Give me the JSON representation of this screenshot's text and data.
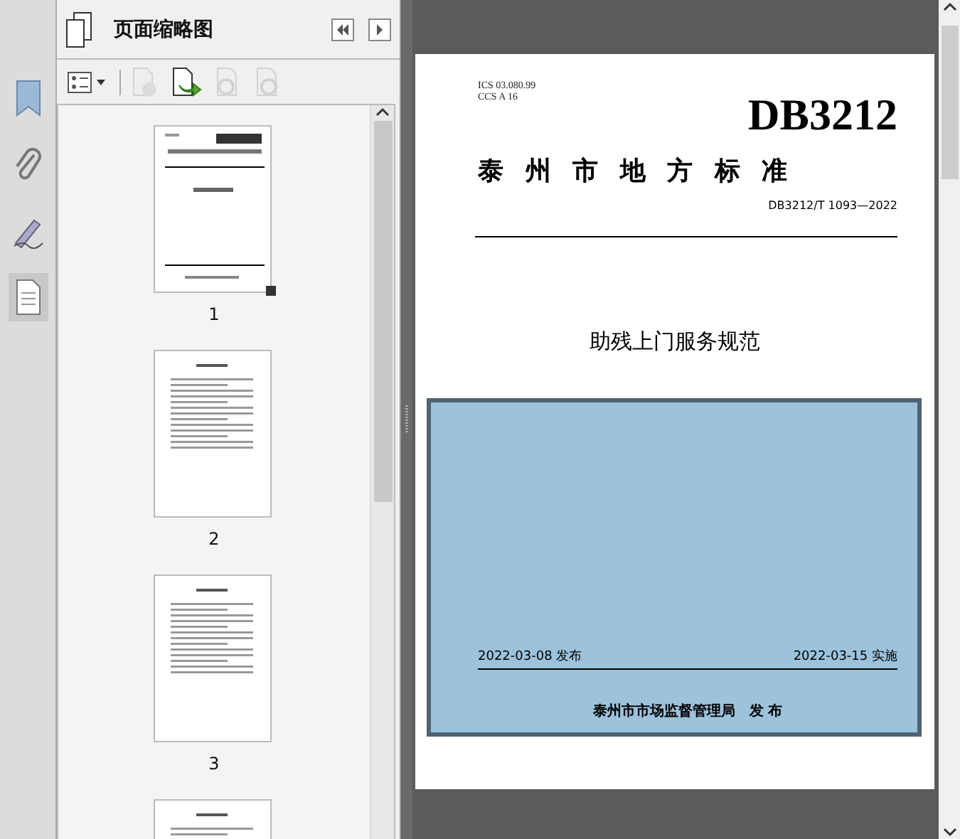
{
  "nav_strip": [
    {
      "kind": "bookmarks",
      "selected": false
    },
    {
      "kind": "attachments",
      "selected": false
    },
    {
      "kind": "signatures",
      "selected": false
    },
    {
      "kind": "pages",
      "selected": true
    }
  ],
  "thumbnail_panel": {
    "title": "页面缩略图",
    "toolbar": [
      {
        "kind": "options",
        "disabled": false
      },
      {
        "kind": "delete",
        "disabled": true
      },
      {
        "kind": "insert",
        "disabled": false
      },
      {
        "kind": "undo",
        "disabled": true
      },
      {
        "kind": "redo",
        "disabled": true
      }
    ],
    "thumbnails": [
      {
        "label": "1",
        "kind": "cover"
      },
      {
        "label": "2",
        "kind": "text"
      },
      {
        "label": "3",
        "kind": "text"
      },
      {
        "kind": "text"
      }
    ]
  },
  "document": {
    "ics": "ICS 03.080.99",
    "ccs": "CCS A 16",
    "code": "DB3212",
    "category": "泰 州 市 地 方 标 准",
    "number": "DB3212/T 1093—2022",
    "title": "助残上门服务规范",
    "issue_date": "2022-03-08 发布",
    "effective_date": "2022-03-15 实施",
    "publisher": "泰州市市场监督管理局　发 布"
  }
}
